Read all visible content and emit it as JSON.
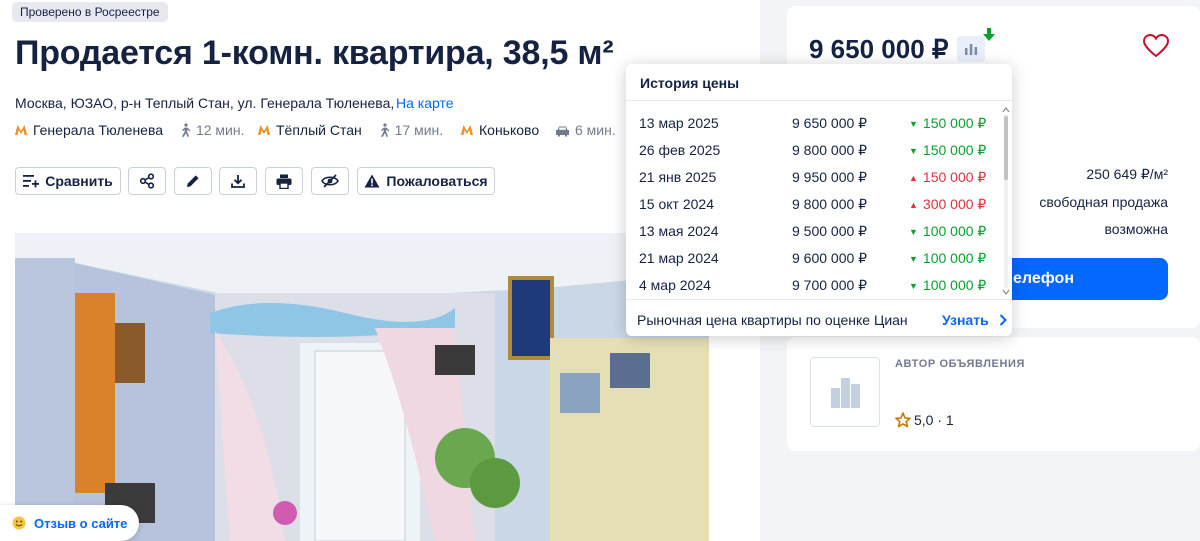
{
  "badge": "Проверено в Росреестре",
  "title": "Продается 1-комн. квартира, 38,5 м²",
  "address": "Москва, ЮЗАО, р-н Теплый Стан, ул. Генерала Тюленева,",
  "map_link": "На карте",
  "metro": [
    {
      "station": "Генерала Тюленева",
      "time": "12 мин.",
      "transport": "walk-icon"
    },
    {
      "station": "Тёплый Стан",
      "time": "17 мин.",
      "transport": "walk-icon"
    },
    {
      "station": "Коньково",
      "time": "6 мин.",
      "transport": "car-icon"
    }
  ],
  "metro_color": "#f28c1f",
  "actions": {
    "compare": "Сравнить",
    "complain": "Пожаловаться"
  },
  "feedback": "Отзыв о сайте",
  "price_card": {
    "price": "9 650 000 ₽",
    "per_m2": "250 649 ₽/м²",
    "sale_type": "свободная продажа",
    "mortgage": "возможна",
    "phone_button": "елефон"
  },
  "author": {
    "label": "АВТОР ОБЪЯВЛЕНИЯ",
    "rating": "5,0 · 1"
  },
  "price_history": {
    "title": "История цены",
    "rows": [
      {
        "date": "13 мар 2025",
        "price": "9 650 000 ₽",
        "change": "150 000 ₽",
        "dir": "down"
      },
      {
        "date": "26 фев 2025",
        "price": "9 800 000 ₽",
        "change": "150 000 ₽",
        "dir": "down"
      },
      {
        "date": "21 янв 2025",
        "price": "9 950 000 ₽",
        "change": "150 000 ₽",
        "dir": "up"
      },
      {
        "date": "15 окт 2024",
        "price": "9 800 000 ₽",
        "change": "300 000 ₽",
        "dir": "up"
      },
      {
        "date": "13 мая 2024",
        "price": "9 500 000 ₽",
        "change": "100 000 ₽",
        "dir": "down"
      },
      {
        "date": "21 мар 2024",
        "price": "9 600 000 ₽",
        "change": "100 000 ₽",
        "dir": "down"
      },
      {
        "date": "4 мар 2024",
        "price": "9 700 000 ₽",
        "change": "100 000 ₽",
        "dir": "down"
      }
    ],
    "footer": "Рыночная цена квартиры по оценке Циан",
    "learn_more": "Узнать"
  },
  "colors": {
    "accent": "#0468ff",
    "drop": "#0a9f2e",
    "rise": "#e0313f"
  }
}
